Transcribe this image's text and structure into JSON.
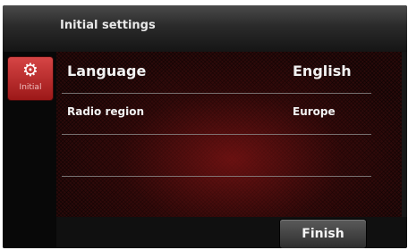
{
  "header": {
    "title": "Initial settings"
  },
  "sidebar": {
    "tab": {
      "label": "Initial",
      "icon": "gear-icon"
    }
  },
  "settings": {
    "rows": [
      {
        "label": "Language",
        "value": "English"
      },
      {
        "label": "Radio region",
        "value": "Europe"
      }
    ]
  },
  "footer": {
    "finish_label": "Finish"
  },
  "colors": {
    "accent": "#c62828",
    "panel": "#2a0a0a"
  }
}
